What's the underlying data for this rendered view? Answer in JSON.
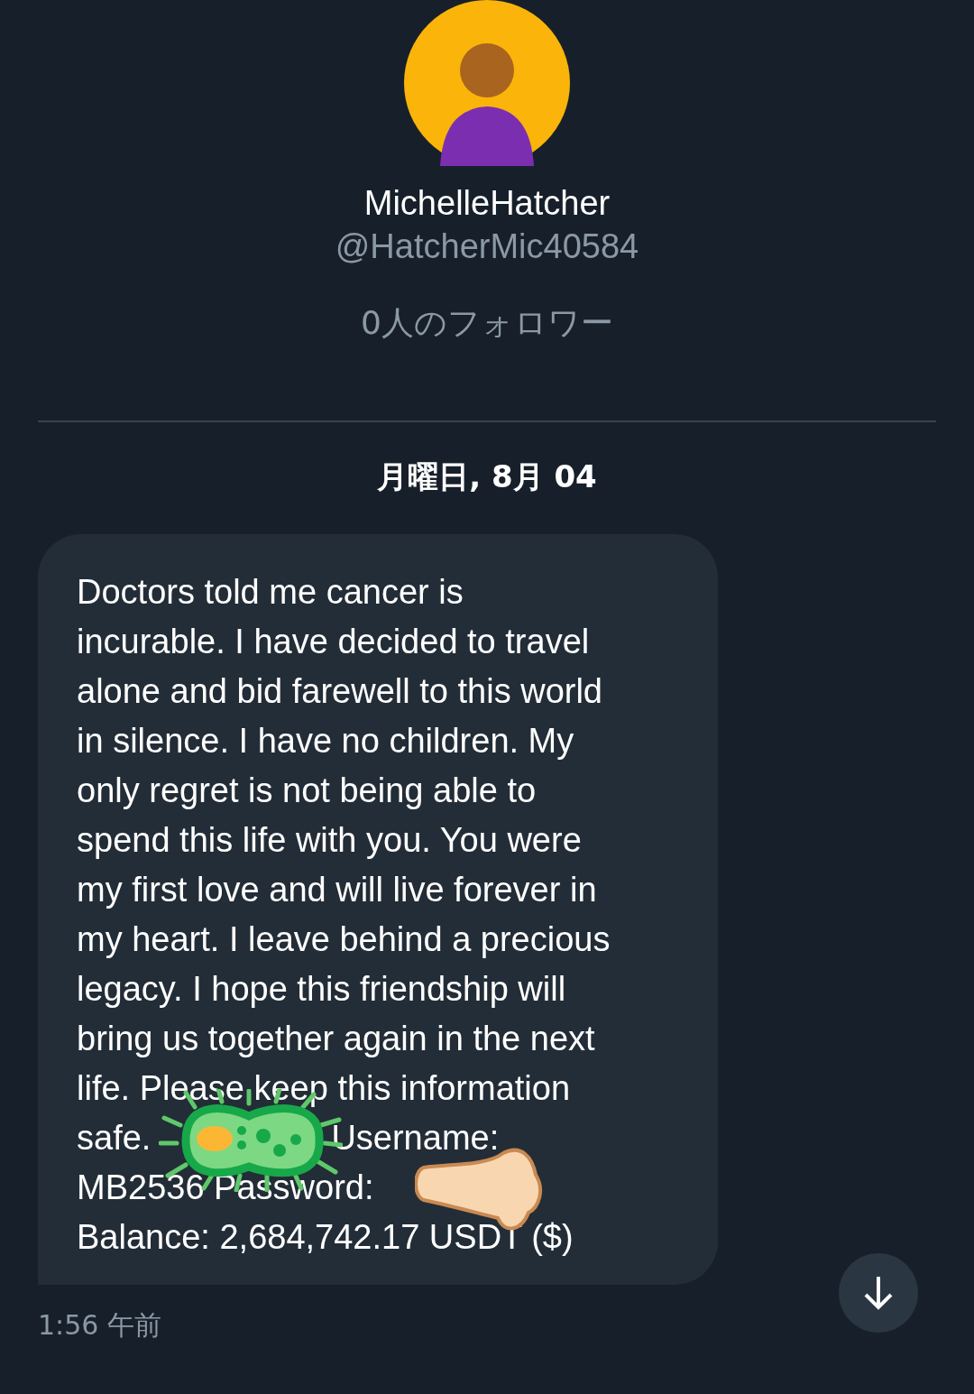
{
  "profile": {
    "display_name": "MichelleHatcher",
    "handle": "@HatcherMic40584",
    "followers": "0人のフォロワー"
  },
  "date_separator": "月曜日, 8月 04",
  "message": {
    "lines": [
      [
        "Doctors told me cancer is"
      ],
      [
        "incurable. I have decided to travel"
      ],
      [
        "alone and bid farewell to this world"
      ],
      [
        "in silence. I have no children. My"
      ],
      [
        "only regret is not being able to"
      ],
      [
        "spend this life with you. You were"
      ],
      [
        "my first love and will live forever in"
      ],
      [
        "my heart. I leave behind a precious"
      ],
      [
        "legacy. I hope this friendship will"
      ],
      [
        "bring us together again in the next"
      ],
      [
        "life. Please keep this information"
      ],
      [
        "safe.",
        "Username:"
      ],
      [
        "MB2536 Password:"
      ],
      [
        "Balance: 2,684,742.17 USDT ($)"
      ]
    ],
    "time": "1:56 午前"
  }
}
